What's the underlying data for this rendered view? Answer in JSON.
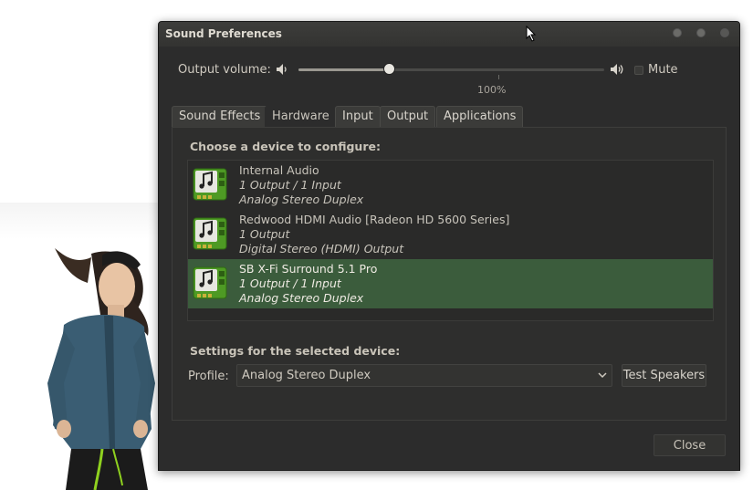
{
  "window": {
    "title": "Sound Preferences"
  },
  "volume": {
    "label": "Output volume:",
    "level_percent": 45,
    "tick_label": "100%",
    "tick_percent": 100,
    "scale_max_percent": 153,
    "mute_label": "Mute",
    "muted": false
  },
  "tabs": [
    {
      "label": "Sound Effects",
      "active": false
    },
    {
      "label": "Hardware",
      "active": true
    },
    {
      "label": "Input",
      "active": false
    },
    {
      "label": "Output",
      "active": false
    },
    {
      "label": "Applications",
      "active": false
    }
  ],
  "hardware": {
    "choose_label": "Choose a device to configure:",
    "devices": [
      {
        "name": "Internal Audio",
        "io": "1 Output / 1 Input",
        "profile": "Analog Stereo Duplex",
        "selected": false
      },
      {
        "name": "Redwood HDMI Audio [Radeon HD 5600 Series]",
        "io": "1 Output",
        "profile": "Digital Stereo (HDMI) Output",
        "selected": false
      },
      {
        "name": "SB X-Fi Surround 5.1 Pro",
        "io": "1 Output / 1 Input",
        "profile": "Analog Stereo Duplex",
        "selected": true
      }
    ],
    "settings_label": "Settings for the selected device:",
    "profile_label": "Profile:",
    "profile_value": "Analog Stereo Duplex",
    "test_button": "Test Speakers"
  },
  "close_button": "Close",
  "icons": {
    "speaker_low": "audio-volume-low-icon",
    "speaker_high": "audio-volume-high-icon",
    "sound_card": "audio-card-icon",
    "dropdown": "chevron-down-icon"
  },
  "colors": {
    "selection": "#3b5c3c",
    "window_bg": "#2c2c2c"
  }
}
